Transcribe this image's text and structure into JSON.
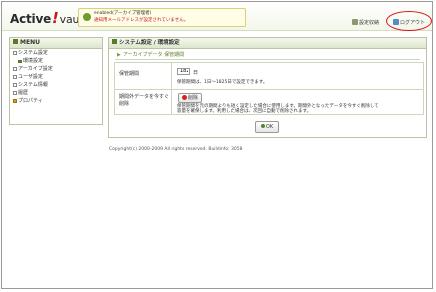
{
  "header": {
    "logo_main": "Active",
    "logo_mark": "!",
    "logo_sub": "vault",
    "user_line": "enabled(アーカイブ管理者)",
    "notice_line": "通知用メールアドレスが設定されていません。",
    "settings_label": "設定収納",
    "logout_label": "ログアウト"
  },
  "sidebar": {
    "title": "MENU",
    "items": [
      {
        "label": "システム設定"
      },
      {
        "label": "環境設定"
      },
      {
        "label": "アーカイブ設定"
      },
      {
        "label": "ユーザ設定"
      },
      {
        "label": "システム情報"
      },
      {
        "label": "履歴"
      },
      {
        "label": "プロパティ"
      }
    ]
  },
  "panel": {
    "title": "システム設定 / 環境設定",
    "subheading": "アーカイブデータ 保管期間",
    "retention_label": "保管期間",
    "retention_value": "1825",
    "retention_unit": "日",
    "retention_help": "保管期間は、1日〜1825日で設定できます。",
    "expired_label": "期間外データを今すぐ削除",
    "delete_label": "削除",
    "delete_help_1": "保管期間を元の期間よりも短く設定した場合に使用します。期間外となったデータを今すぐ削除して",
    "delete_help_2": "容量を確保します。利用した場合は、次回に自動で削除されます。",
    "ok_label": "OK"
  },
  "footer": {
    "copyright": "Copyright(c) 2000-2009 All rights reserved. Buildinfo: 3058"
  },
  "colors": {
    "accent_green": "#5a7a2a",
    "logout_highlight": "#e01010",
    "logo_mark": "#c8161d"
  }
}
